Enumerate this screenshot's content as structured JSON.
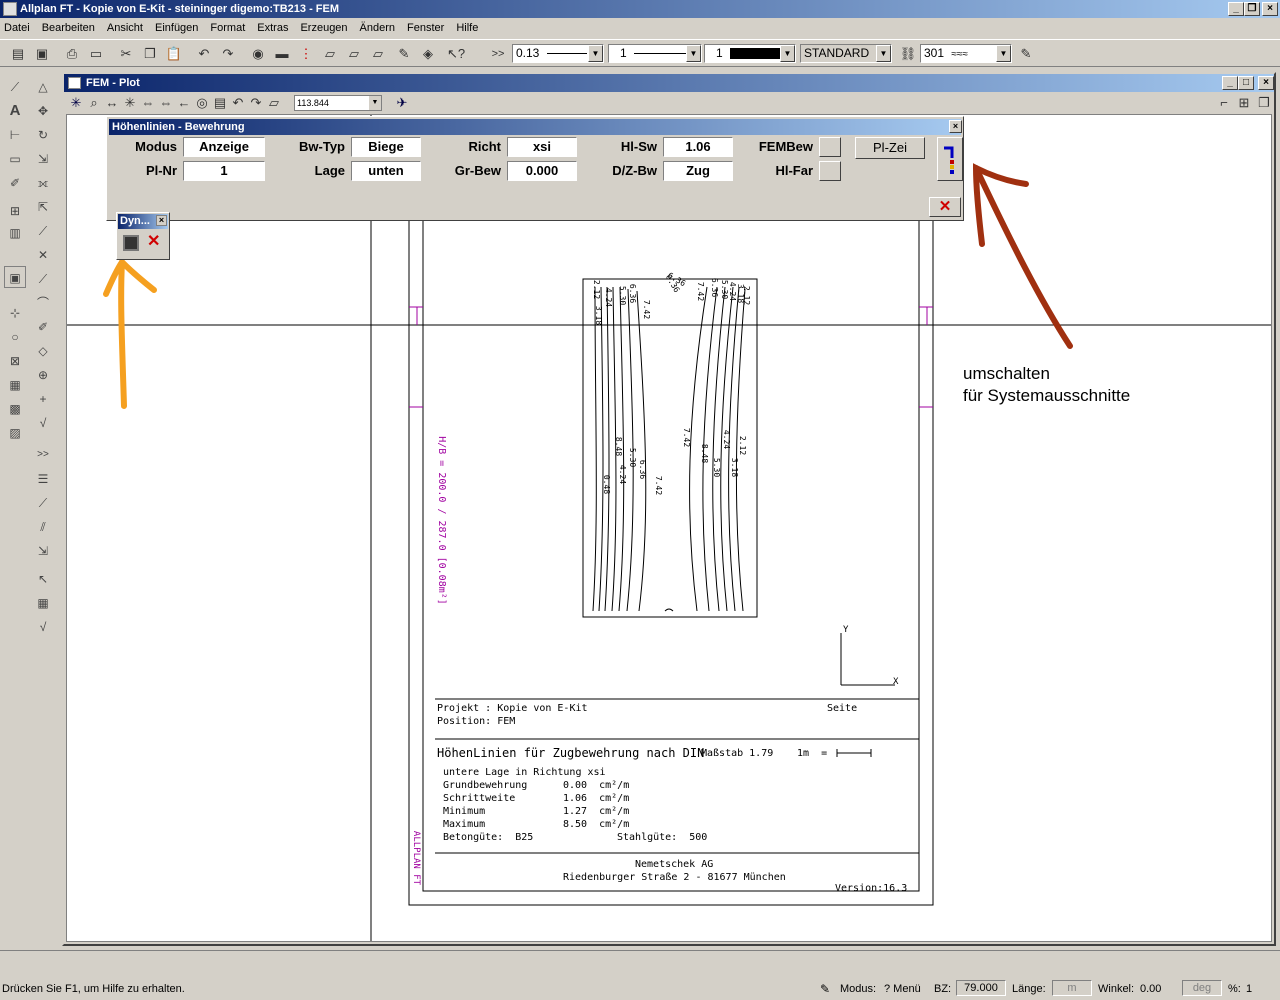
{
  "app": {
    "title": "Allplan FT - Kopie von E-Kit - steininger digemo:TB213 - FEM"
  },
  "menu": [
    "Datei",
    "Bearbeiten",
    "Ansicht",
    "Einfügen",
    "Format",
    "Extras",
    "Erzeugen",
    "Ändern",
    "Fenster",
    "Hilfe"
  ],
  "toolbar": {
    "pen": "0.13",
    "line": "1",
    "color": "1",
    "layer": "STANDARD",
    "hatch": "301",
    "more": ">>"
  },
  "fem_window": {
    "title": "FEM - Plot",
    "zoom": "113.844"
  },
  "dialog": {
    "title": "Höhenlinien - Bewehrung",
    "modus_label": "Modus",
    "modus_value": "Anzeige",
    "plnr_label": "Pl-Nr",
    "plnr_value": "1",
    "bwtyp_label": "Bw-Typ",
    "bwtyp_value": "Biege",
    "lage_label": "Lage",
    "lage_value": "unten",
    "richt_label": "Richt",
    "richt_value": "xsi",
    "grbew_label": "Gr-Bew",
    "grbew_value": "0.000",
    "hlsw_label": "Hl-Sw",
    "hlsw_value": "1.06",
    "dzbw_label": "D/Z-Bw",
    "dzbw_value": "Zug",
    "fembew_label": "FEMBew",
    "hlfar_label": "Hl-Far",
    "plzei_label": "Pl-Zei"
  },
  "dyn": {
    "title": "Dyn..."
  },
  "drawing": {
    "side_text": "H/B = 200.0 / 287.0 [0.08m²]",
    "contour_labels_left": [
      "0.48",
      "4.24",
      "5.30",
      "6.36",
      "7.42",
      "2.12",
      "3.18",
      "4.24",
      "5.30",
      "6.36",
      "7.42",
      "3.18",
      "8.48",
      "6.36"
    ],
    "contour_labels_right": [
      "6.36",
      "7.42",
      "6.36",
      "5.30",
      "4.24",
      "3.18",
      "2.12",
      "7.42",
      "8.48",
      "5.30",
      "4.24",
      "3.18",
      "2.12"
    ],
    "axis_y": "Y",
    "axis_x": "X",
    "projekt_line": "Projekt : Kopie von E-Kit",
    "position_line": "Position: FEM",
    "seite": "Seite",
    "heading": "HöhenLinien für Zugbewehrung nach DIN",
    "massstab": "Maßstab 1.79",
    "scale_unit": "1m  =",
    "lage_line": "untere Lage in Richtung xsi",
    "grund_label": "Grundbewehrung",
    "grund_value": "0.00  cm²/m",
    "schritt_label": "Schrittweite",
    "schritt_value": "1.06  cm²/m",
    "min_label": "Minimum",
    "min_value": "1.27  cm²/m",
    "max_label": "Maximum",
    "max_value": "8.50  cm²/m",
    "beton_line": "Betongüte:  B25",
    "stahl_line": "Stahlgüte:  500",
    "company": "Nemetschek AG",
    "address": "Riedenburger Straße 2 - 81677 München",
    "version": "Version:16.3",
    "vertical_brand": "ALLPLAN FT"
  },
  "annotation": {
    "line1": "umschalten",
    "line2": "für Systemausschnitte"
  },
  "status": {
    "help": "Drücken Sie F1, um Hilfe zu erhalten.",
    "modus_label": "Modus:",
    "modus_value": "? Menü",
    "bz_label": "BZ:",
    "bz_value": "79.000",
    "laenge_label": "Länge:",
    "laenge_unit": "m",
    "winkel_label": "Winkel:",
    "winkel_value": "0.00",
    "winkel_unit": "deg",
    "pct_label": "%:",
    "pct_value": "1"
  },
  "colors": {
    "titlebar": "#0a246a",
    "annot_orange": "#f5a020",
    "annot_brown": "#a03010",
    "magenta": "#a000a0"
  }
}
